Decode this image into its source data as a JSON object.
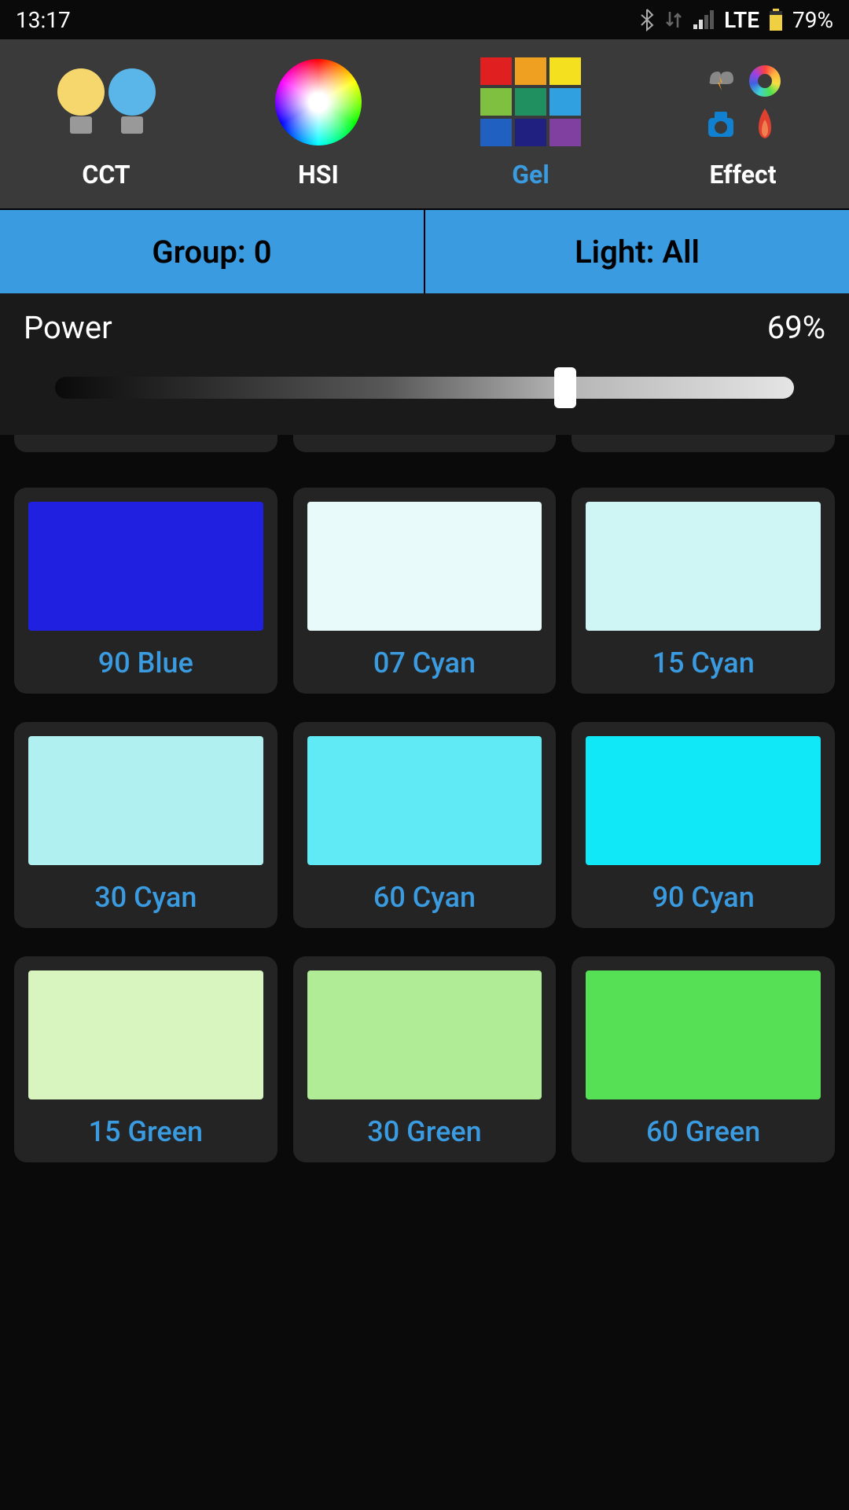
{
  "status": {
    "time": "13:17",
    "network": "LTE",
    "battery": "79%"
  },
  "tabs": {
    "cct": "CCT",
    "hsi": "HSI",
    "gel": "Gel",
    "effect": "Effect",
    "active": "gel"
  },
  "selectors": {
    "group": "Group: 0",
    "light": "Light: All"
  },
  "power": {
    "label": "Power",
    "value": "69%",
    "percent": 69
  },
  "gels": [
    {
      "label": "90 Blue",
      "color": "#2020e0"
    },
    {
      "label": "07 Cyan",
      "color": "#e8fafa"
    },
    {
      "label": "15 Cyan",
      "color": "#d0f5f5"
    },
    {
      "label": "30 Cyan",
      "color": "#b0f0f0"
    },
    {
      "label": "60 Cyan",
      "color": "#60eaf5"
    },
    {
      "label": "90 Cyan",
      "color": "#10e8f8"
    },
    {
      "label": "15 Green",
      "color": "#d8f5c0"
    },
    {
      "label": "30 Green",
      "color": "#b0eb95"
    },
    {
      "label": "60 Green",
      "color": "#55e055"
    }
  ],
  "gel_grid_colors": [
    "#e02020",
    "#f0a020",
    "#f5e020",
    "#80c040",
    "#209060",
    "#30a0e0",
    "#2060c0",
    "#202080",
    "#8040a0"
  ]
}
